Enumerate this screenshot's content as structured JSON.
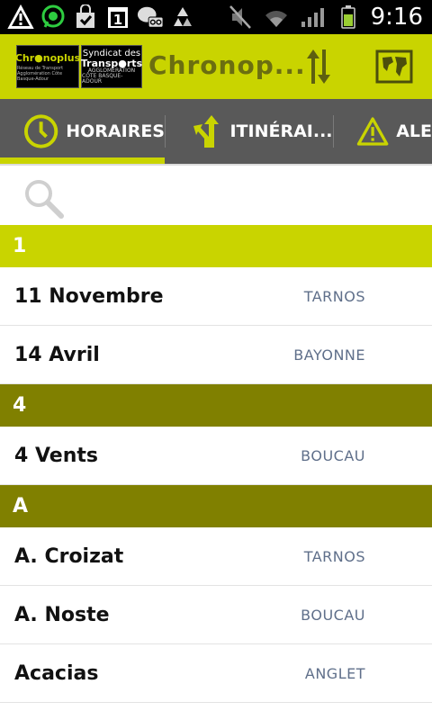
{
  "status_bar": {
    "time": "9:16",
    "left_icons": [
      "warning-icon",
      "whatsapp-icon",
      "shopping-bag-icon",
      "calendar-icon",
      "voicemail-icon",
      "recycle-icon"
    ],
    "right_icons": [
      "vibrate-mute-icon",
      "wifi-icon",
      "signal-icon",
      "battery-icon"
    ]
  },
  "app_bar": {
    "title": "Chronop...",
    "logo_left": {
      "line1": "Chr●noplus",
      "line2": "Réseau de Transport Agglomération Côte Basque-Adour"
    },
    "logo_right": {
      "line1": "Syndicat des",
      "line2": "Transp●rts",
      "line3": "AGGLOMERATION",
      "line4": "CÔTE BASQUE-ADOUR"
    },
    "actions": [
      "sort-icon",
      "map-icon"
    ]
  },
  "tabs": [
    {
      "label": "HORAIRES",
      "icon": "clock-icon",
      "active": true
    },
    {
      "label": "ITINÉRAI...",
      "icon": "route-icon",
      "active": false
    },
    {
      "label": "ALE",
      "icon": "alert-icon",
      "active": false
    }
  ],
  "colors": {
    "accent": "#c9d400",
    "section_olive": "#808000",
    "tab_bg": "#595959",
    "town_text": "#5f6f8a"
  },
  "sections": [
    {
      "header": "1",
      "style": "lime",
      "rows": [
        {
          "name": "11 Novembre",
          "town": "TARNOS"
        },
        {
          "name": "14 Avril",
          "town": "BAYONNE"
        }
      ]
    },
    {
      "header": "4",
      "style": "olive",
      "rows": [
        {
          "name": "4 Vents",
          "town": "BOUCAU"
        }
      ]
    },
    {
      "header": "A",
      "style": "olive",
      "rows": [
        {
          "name": "A. Croizat",
          "town": "TARNOS"
        },
        {
          "name": "A. Noste",
          "town": "BOUCAU"
        },
        {
          "name": "Acacias",
          "town": "ANGLET"
        }
      ]
    }
  ]
}
